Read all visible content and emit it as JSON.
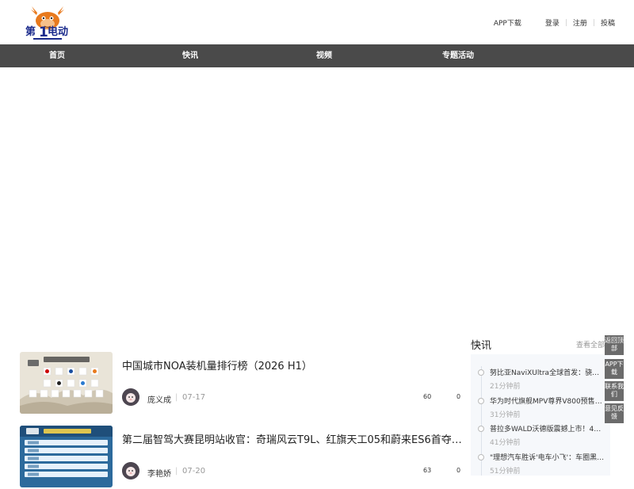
{
  "header": {
    "logo_text": "第1电动",
    "app_download": "APP下载",
    "login": "登录",
    "register": "注册",
    "submit": "投稿",
    "separator": "|"
  },
  "nav": {
    "items": [
      {
        "label": "首页"
      },
      {
        "label": "快讯"
      },
      {
        "label": "视频"
      },
      {
        "label": "专题活动"
      }
    ]
  },
  "articles": [
    {
      "title": "中国城市NOA装机量排行榜（2026 H1）",
      "author": "庞义成",
      "date": "07-17",
      "views": "60",
      "comments": "0"
    },
    {
      "title": "第二届智驾大赛昆明站收官：奇瑞风云T9L、红旗天工05和蔚来ES6首夺…",
      "author": "李艳娇",
      "date": "07-20",
      "views": "63",
      "comments": "0"
    }
  ],
  "sidebar": {
    "title": "快讯",
    "more": "查看全部",
    "flash_news": [
      {
        "text": "努比亚NaviXUltra全球首发：骁龙8…",
        "time": "21分钟前"
      },
      {
        "text": "华为时代旗舰MPV尊界V800预售2…",
        "time": "31分钟前"
      },
      {
        "text": "普拉多WALD沃德版震撼上市！44.…",
        "time": "41分钟前"
      },
      {
        "text": "\"理想汽车胜诉'电车小飞'：车圈黑…",
        "time": "51分钟前"
      }
    ]
  },
  "float_tools": [
    {
      "label": "返回顶部"
    },
    {
      "label": "APP下载"
    },
    {
      "label": "联系我们"
    },
    {
      "label": "意见反馈"
    }
  ],
  "colors": {
    "nav_bg": "#4a4a4a",
    "accent_blue": "#1a2a8c",
    "logo_orange": "#e87a1e"
  }
}
